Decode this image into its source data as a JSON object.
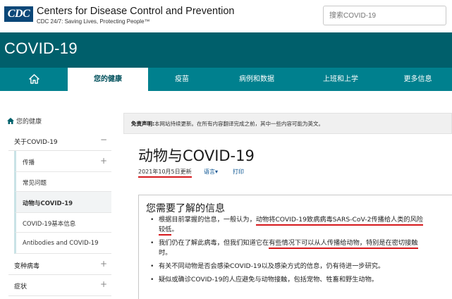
{
  "header": {
    "logo_text": "CDC",
    "org_name": "Centers for Disease Control and Prevention",
    "tagline": "CDC 24/7: Saving Lives, Protecting People™",
    "search_placeholder": "搜索COVID-19"
  },
  "banner": {
    "title": "COVID-19"
  },
  "nav": {
    "home_icon": "home-icon",
    "items": [
      {
        "label": "您的健康",
        "active": true
      },
      {
        "label": "疫苗"
      },
      {
        "label": "病例和数据"
      },
      {
        "label": "上班和上学"
      },
      {
        "label": "更多信息"
      }
    ]
  },
  "sidebar": {
    "home_label": "您的健康",
    "items": [
      {
        "label": "关于COVID-19",
        "toggle": "−"
      },
      {
        "label": "传播",
        "toggle": "+"
      },
      {
        "label": "常见问题"
      },
      {
        "label": "动物与COVID-19",
        "active": true
      },
      {
        "label": "COVID-19基本信息"
      },
      {
        "label": "Antibodies and COVID-19"
      },
      {
        "label": "变种病毒",
        "toggle": "+"
      },
      {
        "label": "症状",
        "toggle": "+"
      }
    ]
  },
  "disclaimer": {
    "label": "免责声明:",
    "text": "本网站持续更新。在所有内容翻译完成之前，其中一些内容可能为英文。"
  },
  "main": {
    "title": "动物与COVID-19",
    "updated": "2021年10月5日更新",
    "language": "语言",
    "language_caret": "▾",
    "print": "打印",
    "section_title": "您需要了解的信息",
    "bullets": [
      {
        "pre": "根据目前掌握的信息，一般认为，",
        "highlight": "动物将COVID-19致病病毒SARS-CoV-2传播给人类的风险",
        "highlight2": "较低",
        "post": "。"
      },
      {
        "pre": "我们仍在了解此病毒，但我们知道它在",
        "highlight": "有些情况下可以从人传播给动物，特别是在密切接触",
        "post": "时。"
      },
      {
        "text": "有关不同动物是否会感染COVID-19以及感染方式的信息，仍有待进一步研究。"
      },
      {
        "text": "疑似或确诊COVID-19的人应避免与动物接触，包括宠物、牲畜和野生动物。"
      }
    ]
  },
  "colors": {
    "banner": "#005f6b",
    "nav": "#00808e",
    "cdc_blue": "#0b4778",
    "annotation_red": "#d6191c"
  }
}
